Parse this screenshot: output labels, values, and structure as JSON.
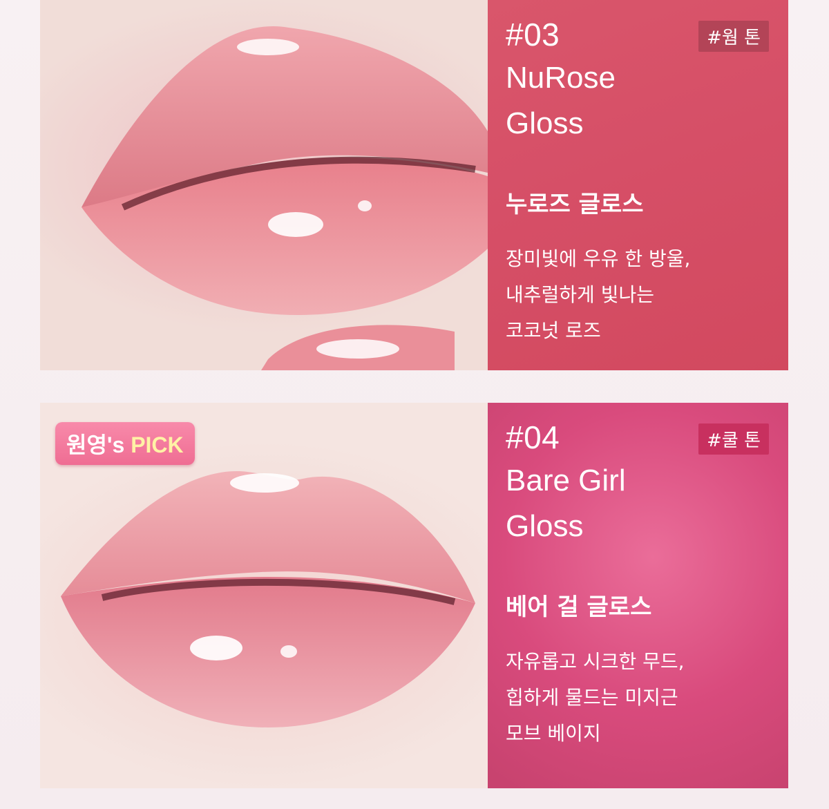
{
  "products": [
    {
      "number": "#03",
      "name_line1": "NuRose",
      "name_line2": "Gloss",
      "tag": "#웜 톤",
      "korean_name": "누로즈 글로스",
      "desc_lines": [
        "장미빛에 우유 한 방울,",
        "내추럴하게 빛나는",
        "코코넛 로즈"
      ]
    },
    {
      "number": "#04",
      "name_line1": "Bare Girl",
      "name_line2": "Gloss",
      "tag": "#쿨 톤",
      "korean_name": "베어 걸 글로스",
      "desc_lines": [
        "자유롭고 시크한 무드,",
        "힙하게 물드는 미지근",
        "모브 베이지"
      ],
      "badge_part1": "원영's ",
      "badge_part2": "PICK"
    }
  ],
  "colors": {
    "panel_03": "#d9566b",
    "panel_04": "#e0578a",
    "tag_03": "#b34457",
    "tag_04": "#c8305f",
    "badge": "#f17a9e"
  }
}
